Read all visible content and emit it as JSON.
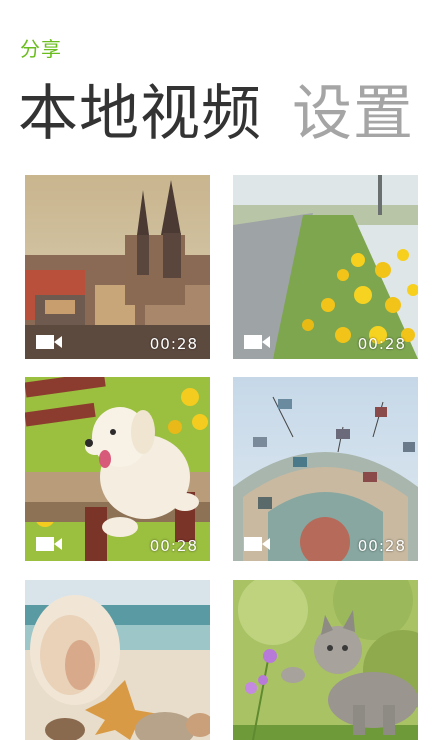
{
  "header": {
    "app_label": "分享",
    "tabs": [
      {
        "label": "本地视频",
        "active": true
      },
      {
        "label": "设置",
        "active": false
      }
    ]
  },
  "colors": {
    "accent": "#6bbd1f",
    "active_tab": "#333333",
    "inactive_tab": "#a5a5a5"
  },
  "videos": [
    {
      "subject": "prague-old-town-castle",
      "duration": "00:28",
      "icon": "video-camera-icon"
    },
    {
      "subject": "yellow-flowers-roadside",
      "duration": "00:28",
      "icon": "video-camera-icon"
    },
    {
      "subject": "puppy-on-bench",
      "duration": "00:28",
      "icon": "video-camera-icon"
    },
    {
      "subject": "swing-ride-carousel",
      "duration": "00:28",
      "icon": "video-camera-icon"
    },
    {
      "subject": "seashells-on-beach",
      "duration": "",
      "icon": ""
    },
    {
      "subject": "kitten-and-flowers",
      "duration": "",
      "icon": ""
    }
  ]
}
